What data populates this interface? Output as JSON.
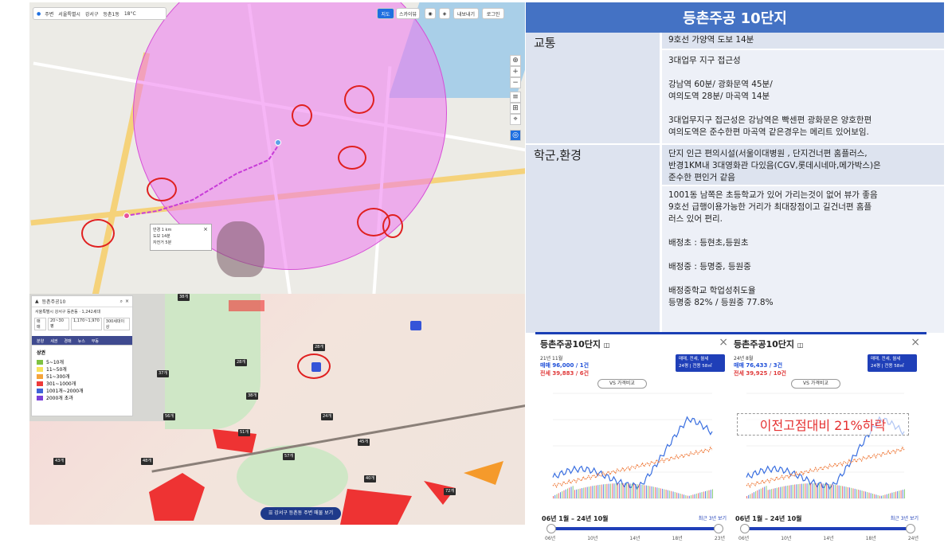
{
  "title": "등촌주공 10단지",
  "sections": [
    {
      "category": "교통",
      "rows": [
        "9호선 가양역 도보 14분",
        "3대업무 지구 접근성\n\n강남역 60분/ 광화문역 45분/\n여의도역 28분/ 마곡역 14분\n\n3대업무지구 접근성은 강남역은 빡센편 광화문은 양호한편\n여의도역은 준수한편 마곡역 같은경우는 메리트 있어보임."
      ]
    },
    {
      "category": "학군,환경",
      "rows": [
        "단지 인근 편의시설(서울이대병원 , 단지건너편 홈플러스,\n반경1KM내 3대영화관 다있음(CGV,롯데시네마,메가박스)은\n준수한 편인거 같음",
        "1001동 남쪽은 초등학교가 있어 가리는것이 없어 뷰가 좋음\n9호선 급행이용가능한 거리가 최대장점이고 길건너편 홈플\n러스 있어 편리.\n\n배정초 : 등현초,등원초\n\n배정중 : 등명중, 등원중\n\n배정중학교 학업성취도율\n등명중 82% / 등원중 77.8%"
      ]
    }
  ],
  "map_top": {
    "toolbar_items": [
      "주변",
      "서울특별시",
      "강서구",
      "등촌1동",
      "18°C"
    ],
    "map_btn": "지도",
    "sky_btn": "스카이뷰",
    "share_btn": "내보내기",
    "login_btn": "로그인",
    "popup_lines": [
      "반경  1 km",
      "도보  14분",
      "자전거  5분"
    ]
  },
  "map_bottom": {
    "search_value": "등촌주공10",
    "address": "서울특별시 강서구 등촌동 · 1,242세대",
    "filters": [
      "매매",
      "20~30평",
      "1,170~1,970",
      "300세대이상"
    ],
    "tabs": [
      "분양",
      "세권",
      "경매",
      "뉴스",
      "부동"
    ],
    "legend_title": "상권",
    "legend": [
      {
        "label": "5~10개",
        "color": "#7fc241"
      },
      {
        "label": "11~50개",
        "color": "#f7e25a"
      },
      {
        "label": "51~300개",
        "color": "#f5a43a"
      },
      {
        "label": "301~1000개",
        "color": "#ee3a3a"
      },
      {
        "label": "1001개~2000개",
        "color": "#3f63d8"
      },
      {
        "label": "2000개 초과",
        "color": "#7a3fd8"
      }
    ],
    "bottom_button": "강서구 등촌동 주변 매물 보기",
    "tags": [
      "38개",
      "28개",
      "28개",
      "37개",
      "38개",
      "56개",
      "24개",
      "51개",
      "45개",
      "57개",
      "48개",
      "43개",
      "40개",
      "72개"
    ]
  },
  "cards": [
    {
      "title": "등촌주공10단지",
      "date": "21년 11월",
      "sale": "매매 96,000 / 1건",
      "jeonse": "전세 39,883 / 6건",
      "deal_type": "매매, 전세, 월세",
      "area": "24평 | 전용 58㎡",
      "vs": "VS 가격비교",
      "period": "06년 1월 – 24년 10월",
      "recent": "최근 3년 보기",
      "ticks": [
        "06년",
        "10년",
        "14년",
        "18년",
        "23년"
      ]
    },
    {
      "title": "등촌주공10단지",
      "date": "24년 8월",
      "sale": "매매 76,433 / 3건",
      "jeonse": "전세 39,925 / 10건",
      "deal_type": "매매, 전세, 월세",
      "area": "24평 | 전용 58㎡",
      "vs": "VS 가격비교",
      "period": "06년 1월 – 24년 10월",
      "recent": "최근 3년 보기",
      "ticks": [
        "06년",
        "10년",
        "14년",
        "18년",
        "24년"
      ]
    }
  ],
  "annotation": "이전고점대비 21%하락"
}
